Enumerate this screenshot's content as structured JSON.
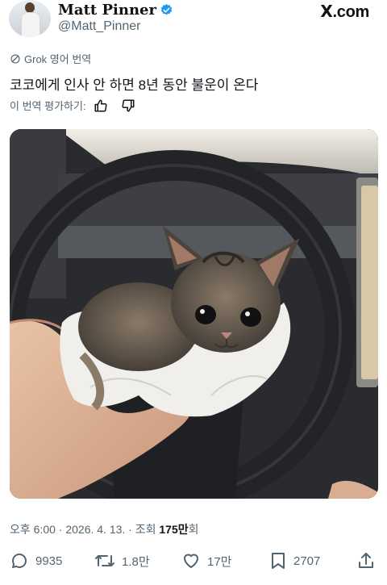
{
  "author": {
    "name": "Matt Pinner",
    "handle": "@Matt_Pinner",
    "verified_color": "#1d9bf0",
    "avatar_icon": "avatar-person"
  },
  "brand": {
    "mark": "X",
    "suffix": ".com"
  },
  "translation": {
    "label": "Grok 영어 번역",
    "icon": "grok-icon"
  },
  "tweet": {
    "text": "코코에게 인사 안 하면 8년 동안 불운이 온다"
  },
  "rating": {
    "label": "이 번역 평가하기:",
    "icons": [
      "thumbs-up-icon",
      "thumbs-down-icon"
    ]
  },
  "media": {
    "description_icon": "photo-kitten"
  },
  "meta": {
    "time_date": "오후 6:00 · 2026. 4. 13. · 조회 ",
    "views_number": "175만",
    "views_suffix": "회"
  },
  "actions": {
    "replies": "9935",
    "reposts": "1.8만",
    "likes": "17만",
    "bookmarks": "2707"
  },
  "colors": {
    "text": "#0f1419",
    "secondary": "#536471",
    "accent": "#1d9bf0"
  }
}
